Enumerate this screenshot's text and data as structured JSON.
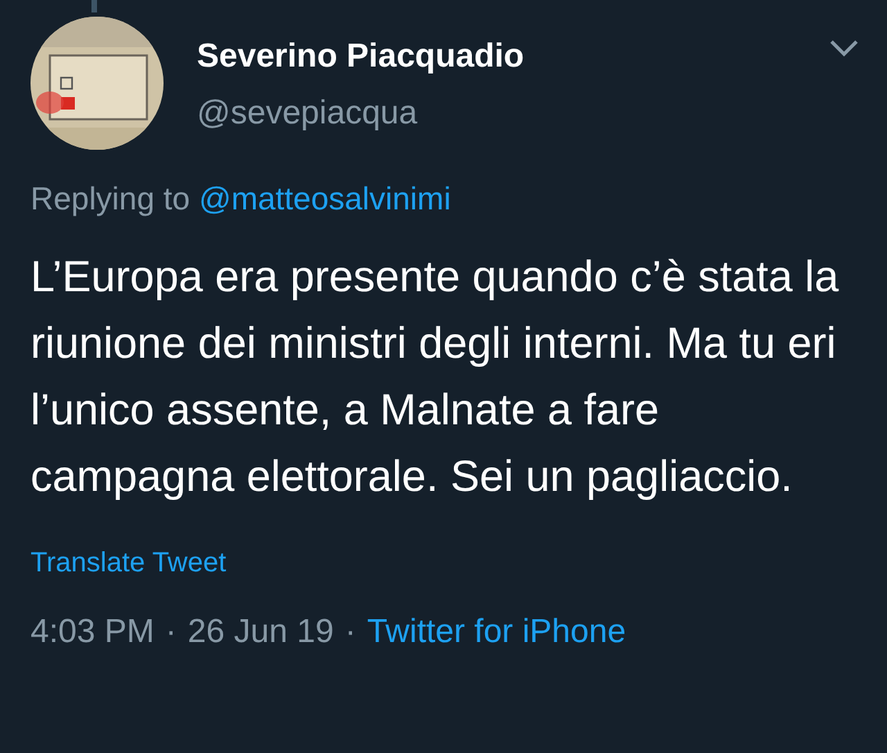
{
  "author": {
    "name": "Severino Piacquadio",
    "handle": "@sevepiacqua"
  },
  "reply": {
    "label": "Replying to",
    "mention": "@matteosalvinimi"
  },
  "text": "L’Europa era presente quando c’è stata la riunione dei ministri degli interni. Ma tu eri l’unico assente, a Malnate a fare campagna elettorale. Sei un pagliaccio.",
  "translate": "Translate Tweet",
  "meta": {
    "time": "4:03 PM",
    "dot_1": "·",
    "date": "26 Jun 19",
    "dot_2": "·",
    "source": "Twitter for iPhone"
  }
}
